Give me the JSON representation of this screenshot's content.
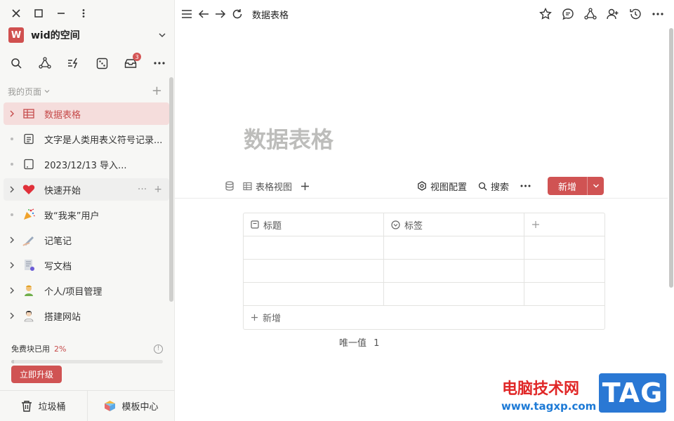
{
  "sidebar": {
    "workspace": {
      "avatar_letter": "W",
      "name": "wid的空间"
    },
    "tools": [
      {
        "icon": "search-icon"
      },
      {
        "icon": "graph-icon"
      },
      {
        "icon": "flash-icon"
      },
      {
        "icon": "dice-icon"
      },
      {
        "icon": "inbox-icon",
        "badge": "3"
      },
      {
        "icon": "more-icon"
      }
    ],
    "section_label": "我的页面",
    "items": [
      {
        "label": "数据表格",
        "icon": "table-icon",
        "expandable": true
      },
      {
        "label": "文字是人类用表义符号记录...",
        "icon": "doc-icon",
        "expandable": false
      },
      {
        "label": "2023/12/13 导入...",
        "icon": "page-icon",
        "expandable": false
      },
      {
        "label": "快速开始",
        "icon": "heart-icon",
        "expandable": true
      },
      {
        "label": "致“我来”用户",
        "icon": "party-icon",
        "expandable": false
      },
      {
        "label": "记笔记",
        "icon": "pen-icon",
        "expandable": true
      },
      {
        "label": "写文档",
        "icon": "document-icon",
        "expandable": true
      },
      {
        "label": "个人/项目管理",
        "icon": "person-icon",
        "expandable": true
      },
      {
        "label": "搭建网站",
        "icon": "web-icon",
        "expandable": true
      }
    ],
    "usage": {
      "label": "免费块已用",
      "percent_text": "2%",
      "percent": 2
    },
    "upgrade_label": "立即升级",
    "footer": {
      "trash": "垃圾桶",
      "templates": "模板中心"
    }
  },
  "topbar": {
    "title": "数据表格"
  },
  "page": {
    "title": "数据表格",
    "view_label": "表格视图",
    "view_config": "视图配置",
    "search": "搜索",
    "new_label": "新增",
    "columns": [
      "标题",
      "标签"
    ],
    "add_row_label": "新增",
    "unique_label": "唯一值",
    "unique_value": "1"
  },
  "watermark": {
    "text": "电脑技术网",
    "url": "www.tagxp.com",
    "tag": "TAG"
  },
  "colors": {
    "accent": "#d05353",
    "active_bg": "#f5dddc",
    "watermark_blue": "#2a78d4"
  }
}
